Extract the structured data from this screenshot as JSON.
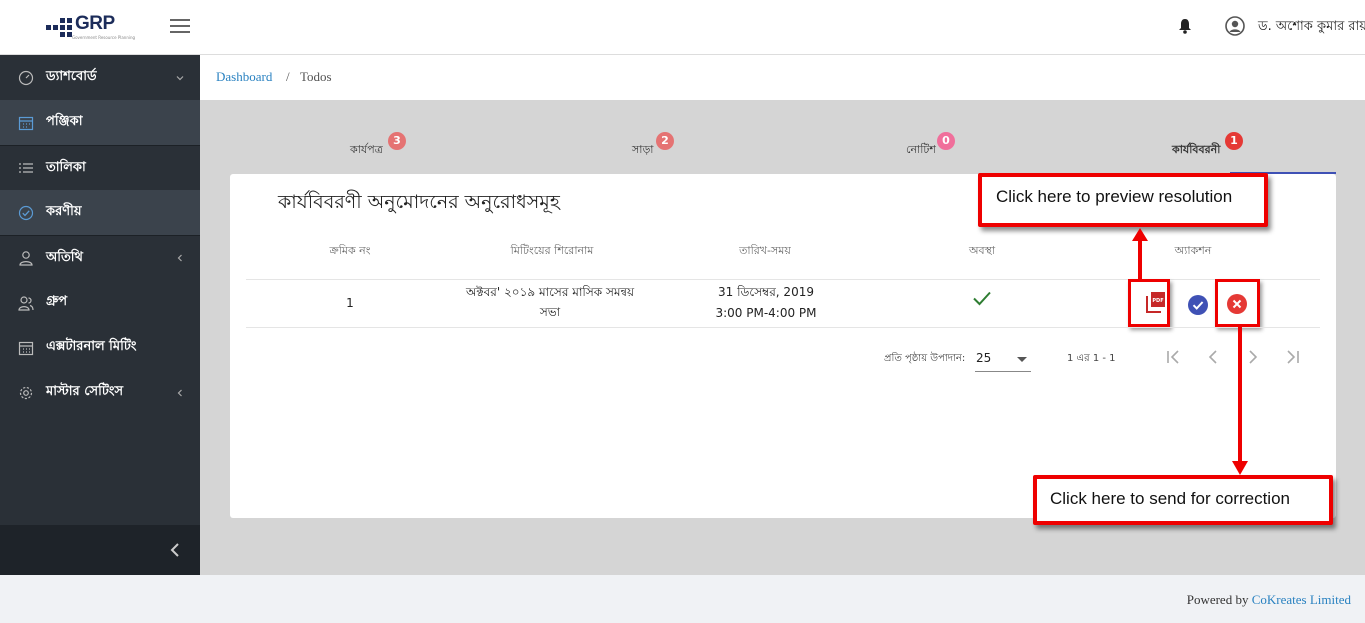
{
  "header": {
    "logo_text": "GRP",
    "logo_subtitle": "Government Resource Planning",
    "user_name": "ড. অশোক কুমার রায়"
  },
  "sidebar": {
    "items": [
      {
        "label": "ড্যাশবোর্ড",
        "icon": "dashboard-icon",
        "chevron": "down"
      },
      {
        "label": "পঞ্জিকা",
        "icon": "calendar-icon"
      },
      {
        "label": "তালিকা",
        "icon": "list-icon"
      },
      {
        "label": "করণীয়",
        "icon": "check-circle-icon"
      },
      {
        "label": "অতিথি",
        "icon": "user-icon",
        "chevron": "left"
      },
      {
        "label": "গ্রুপ",
        "icon": "group-icon"
      },
      {
        "label": "এক্সটারনাল মিটিং",
        "icon": "grid-calendar-icon"
      },
      {
        "label": "মাস্টার সেটিংস",
        "icon": "gear-icon",
        "chevron": "left"
      }
    ]
  },
  "breadcrumb": {
    "link": "Dashboard",
    "separator": "/",
    "current": "Todos"
  },
  "tabs": [
    {
      "label": "কার্যপত্র",
      "badge": "3"
    },
    {
      "label": "সাড়া",
      "badge": "2"
    },
    {
      "label": "নোটিশ",
      "badge": "0"
    },
    {
      "label": "কার্যবিবরনী",
      "badge": "1"
    }
  ],
  "card": {
    "title": "কার্যবিবরণী অনুমোদনের অনুরোধসমূহ",
    "columns": [
      "ক্রমিক নং",
      "মিটিংয়ের শিরোনাম",
      "তারিখ-সময়",
      "অবস্থা",
      "অ্যাকশন"
    ],
    "rows": [
      {
        "serial": "1",
        "title_line1": "অক্টবর' ২০১৯ মাসের মাসিক সমন্বয়",
        "title_line2": "সভা",
        "date": "31 ডিসেম্বর, 2019",
        "time": "3:00 PM-4:00 PM"
      }
    ]
  },
  "paginator": {
    "label": "প্রতি পৃষ্ঠায় উপাদান:",
    "page_size": "25",
    "range": "1 এর 1 - 1"
  },
  "callouts": {
    "preview": "Click here to preview resolution",
    "correction": "Click here to send for correction"
  },
  "footer": {
    "prefix": "Powered by",
    "company": "CoKreates Limited"
  },
  "colors": {
    "sidebar_bg": "#2a3037",
    "accent_blue": "#3f51b5",
    "link_blue": "#2a82c1",
    "badge_red": "#e53935",
    "callout_red": "#ee0000",
    "success_green": "#2e7d32"
  }
}
